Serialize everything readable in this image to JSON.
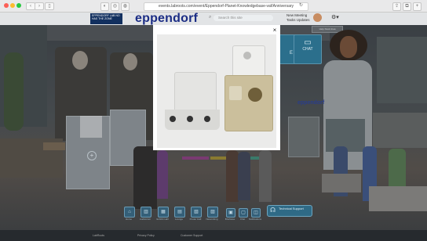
{
  "browser": {
    "url": "events.labroots.com/event/Eppendorf-Planet-Knowledgebase-vaf/Anniversary",
    "icons": [
      "back-icon",
      "forward-icon",
      "sidebar-icon",
      "shield-icon",
      "info-icon",
      "reload-icon",
      "share-icon",
      "tabs-icon",
      "add-tab-icon"
    ]
  },
  "header": {
    "badge_text": "EPPENDORF LAB NO HAS THE ZONE",
    "logo": "eppendorf",
    "search_placeholder": "Search this site",
    "notifications": "New Meeting",
    "tasks": "Tasks Updates"
  },
  "scene": {
    "tile_labels": [
      "E",
      "CHAT"
    ],
    "help_desk": "Help Desk Area",
    "eppendorf_sign": "eppendorf"
  },
  "bottom_nav": {
    "items": [
      "Home",
      "Auditorium",
      "Exhibit Hall",
      "Lounge",
      "Poster Hall",
      "Networking",
      "Briefcase",
      "Chat",
      "Notifications"
    ],
    "support_label": "Technical Support"
  },
  "footer": {
    "links": [
      "LabRoots",
      "Privacy Policy",
      "Customer Support"
    ]
  },
  "colors": {
    "brand_blue": "#1b2d85",
    "badge_navy": "#12305f",
    "tile_teal": "#2b6f8c"
  }
}
